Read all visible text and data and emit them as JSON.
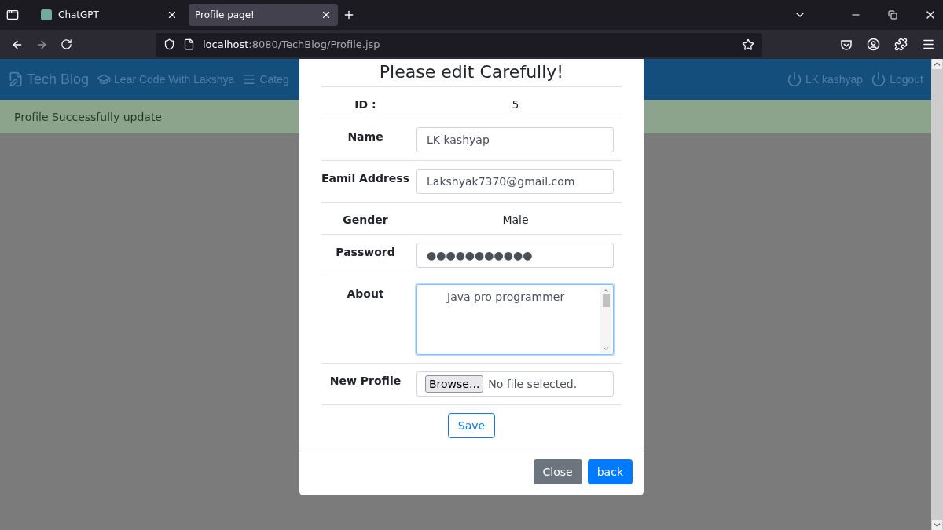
{
  "browser": {
    "tabs": [
      {
        "title": "ChatGPT",
        "selected": false
      },
      {
        "title": "Profile page!",
        "selected": true
      }
    ],
    "url_host": "localhost",
    "url_path": ":8080/TechBlog/Profile.jsp"
  },
  "navbar": {
    "brand": "Tech Blog",
    "items": [
      "Lear Code With Lakshya",
      "Categ"
    ],
    "right_items": [
      "LK kashyap",
      "Logout"
    ]
  },
  "alert": "Profile Successfully update",
  "modal": {
    "title": "Please edit Carefully!",
    "rows": [
      {
        "kind": "text",
        "label": "ID :",
        "value": "5"
      },
      {
        "kind": "input",
        "label": "Name",
        "value": "LK kashyap"
      },
      {
        "kind": "input",
        "label": "Eamil Address",
        "value": "Lakshyak7370@gmail.com"
      },
      {
        "kind": "text",
        "label": "Gender",
        "value": "Male"
      },
      {
        "kind": "password",
        "label": "Password",
        "value": "●●●●●●●●●●●"
      },
      {
        "kind": "textarea",
        "label": "About",
        "value": "Java pro programmer",
        "focused": true
      },
      {
        "kind": "file",
        "label": "New Profile",
        "button": "Browse...",
        "value": "No file selected."
      }
    ],
    "save": "Save",
    "close": "Close",
    "back": "back"
  }
}
